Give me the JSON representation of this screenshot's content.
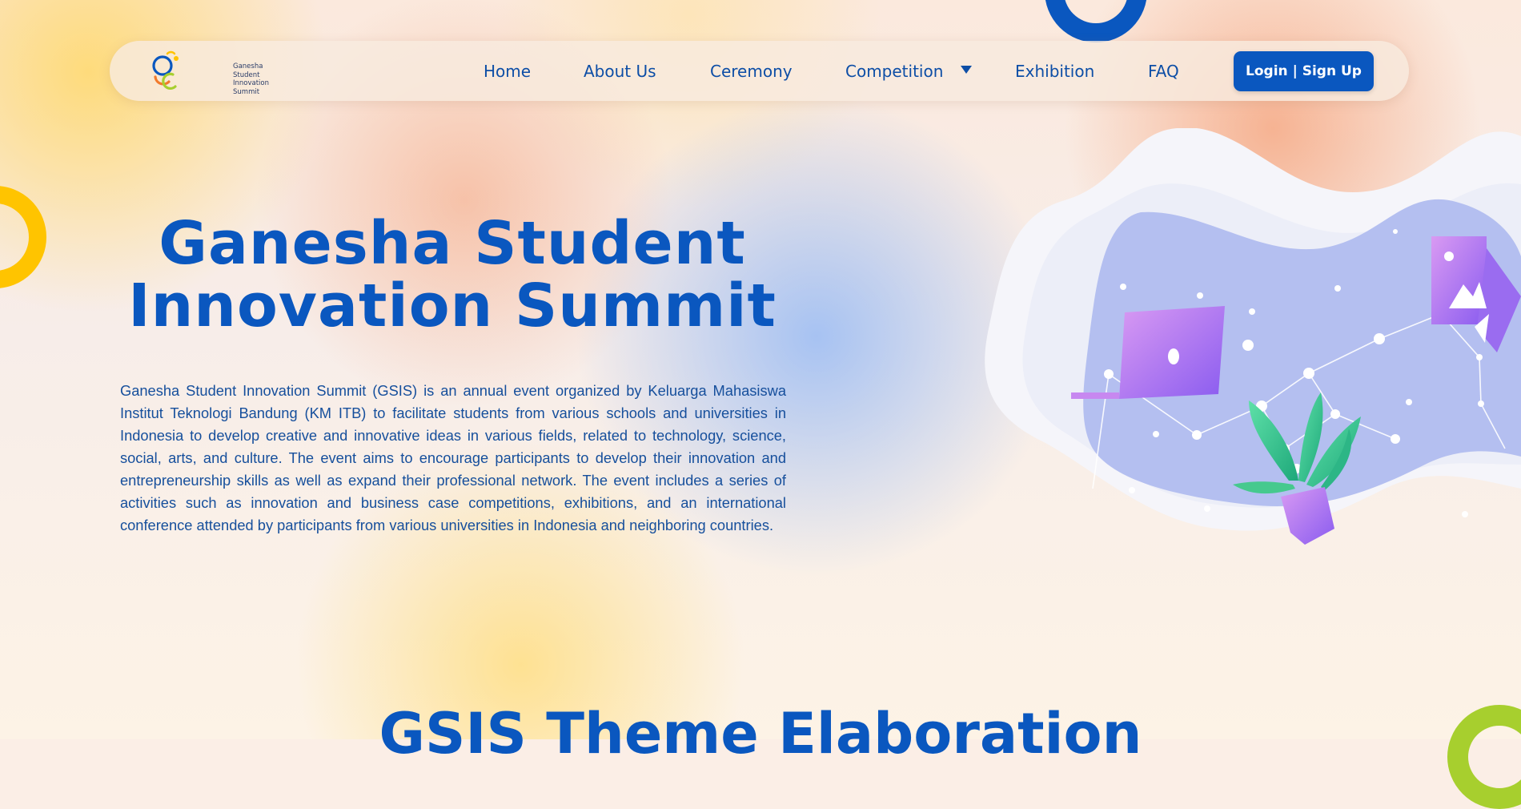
{
  "brand": {
    "logo_lines": [
      "Ganesha",
      "Student",
      "Innovation",
      "Summit"
    ],
    "colors": {
      "primary_blue": "#0a57bf",
      "yellow": "#ffc400",
      "green": "#a7cf2e",
      "orange": "#f27a2c"
    }
  },
  "nav": {
    "items": [
      {
        "label": "Home"
      },
      {
        "label": "About Us"
      },
      {
        "label": "Ceremony"
      },
      {
        "label": "Competition"
      },
      {
        "label": "Exhibition"
      },
      {
        "label": "FAQ"
      }
    ],
    "dropdown_icon": "chevron-down-icon",
    "login_label": "Login | Sign Up"
  },
  "hero": {
    "title_line1": "Ganesha Student",
    "title_line2": "Innovation Summit",
    "description": "Ganesha Student Innovation Summit (GSIS) is an annual event organized by Keluarga Mahasiswa Institut Teknologi Bandung (KM ITB) to facilitate students from various schools and universities in Indonesia to develop creative and innovative ideas in various fields, related to technology, science, social, arts, and culture. The event aims to encourage participants to develop their innovation and entrepreneurship skills as well as expand their professional network. The event includes a series of activities such as innovation and business case competitions, exhibitions, and an international conference attended by participants from various universities in Indonesia and neighboring countries."
  },
  "next_section": {
    "title": "GSIS Theme Elaboration"
  }
}
